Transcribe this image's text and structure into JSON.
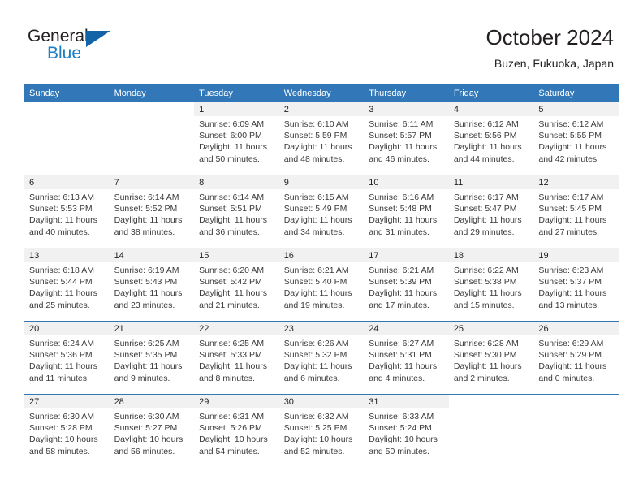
{
  "brand": {
    "word1": "General",
    "word2": "Blue",
    "logo_icon": "triangle-logo-icon",
    "accent_color": "#1263a8"
  },
  "header": {
    "title": "October 2024",
    "subtitle": "Buzen, Fukuoka, Japan"
  },
  "colors": {
    "header_blue": "#3278b9",
    "day_band_gray": "#f1f1f1",
    "text": "#231f20",
    "brand_blue": "#1c7fc4"
  },
  "weekdays": [
    "Sunday",
    "Monday",
    "Tuesday",
    "Wednesday",
    "Thursday",
    "Friday",
    "Saturday"
  ],
  "labels": {
    "sunrise_prefix": "Sunrise:",
    "sunset_prefix": "Sunset:",
    "daylight_prefix": "Daylight:"
  },
  "weeks": [
    [
      {
        "day": "",
        "sunrise": "",
        "sunset": "",
        "daylight": "",
        "blank": true
      },
      {
        "day": "",
        "sunrise": "",
        "sunset": "",
        "daylight": "",
        "blank": true
      },
      {
        "day": "1",
        "sunrise": "Sunrise: 6:09 AM",
        "sunset": "Sunset: 6:00 PM",
        "daylight": "Daylight: 11 hours and 50 minutes."
      },
      {
        "day": "2",
        "sunrise": "Sunrise: 6:10 AM",
        "sunset": "Sunset: 5:59 PM",
        "daylight": "Daylight: 11 hours and 48 minutes."
      },
      {
        "day": "3",
        "sunrise": "Sunrise: 6:11 AM",
        "sunset": "Sunset: 5:57 PM",
        "daylight": "Daylight: 11 hours and 46 minutes."
      },
      {
        "day": "4",
        "sunrise": "Sunrise: 6:12 AM",
        "sunset": "Sunset: 5:56 PM",
        "daylight": "Daylight: 11 hours and 44 minutes."
      },
      {
        "day": "5",
        "sunrise": "Sunrise: 6:12 AM",
        "sunset": "Sunset: 5:55 PM",
        "daylight": "Daylight: 11 hours and 42 minutes."
      }
    ],
    [
      {
        "day": "6",
        "sunrise": "Sunrise: 6:13 AM",
        "sunset": "Sunset: 5:53 PM",
        "daylight": "Daylight: 11 hours and 40 minutes."
      },
      {
        "day": "7",
        "sunrise": "Sunrise: 6:14 AM",
        "sunset": "Sunset: 5:52 PM",
        "daylight": "Daylight: 11 hours and 38 minutes."
      },
      {
        "day": "8",
        "sunrise": "Sunrise: 6:14 AM",
        "sunset": "Sunset: 5:51 PM",
        "daylight": "Daylight: 11 hours and 36 minutes."
      },
      {
        "day": "9",
        "sunrise": "Sunrise: 6:15 AM",
        "sunset": "Sunset: 5:49 PM",
        "daylight": "Daylight: 11 hours and 34 minutes."
      },
      {
        "day": "10",
        "sunrise": "Sunrise: 6:16 AM",
        "sunset": "Sunset: 5:48 PM",
        "daylight": "Daylight: 11 hours and 31 minutes."
      },
      {
        "day": "11",
        "sunrise": "Sunrise: 6:17 AM",
        "sunset": "Sunset: 5:47 PM",
        "daylight": "Daylight: 11 hours and 29 minutes."
      },
      {
        "day": "12",
        "sunrise": "Sunrise: 6:17 AM",
        "sunset": "Sunset: 5:45 PM",
        "daylight": "Daylight: 11 hours and 27 minutes."
      }
    ],
    [
      {
        "day": "13",
        "sunrise": "Sunrise: 6:18 AM",
        "sunset": "Sunset: 5:44 PM",
        "daylight": "Daylight: 11 hours and 25 minutes."
      },
      {
        "day": "14",
        "sunrise": "Sunrise: 6:19 AM",
        "sunset": "Sunset: 5:43 PM",
        "daylight": "Daylight: 11 hours and 23 minutes."
      },
      {
        "day": "15",
        "sunrise": "Sunrise: 6:20 AM",
        "sunset": "Sunset: 5:42 PM",
        "daylight": "Daylight: 11 hours and 21 minutes."
      },
      {
        "day": "16",
        "sunrise": "Sunrise: 6:21 AM",
        "sunset": "Sunset: 5:40 PM",
        "daylight": "Daylight: 11 hours and 19 minutes."
      },
      {
        "day": "17",
        "sunrise": "Sunrise: 6:21 AM",
        "sunset": "Sunset: 5:39 PM",
        "daylight": "Daylight: 11 hours and 17 minutes."
      },
      {
        "day": "18",
        "sunrise": "Sunrise: 6:22 AM",
        "sunset": "Sunset: 5:38 PM",
        "daylight": "Daylight: 11 hours and 15 minutes."
      },
      {
        "day": "19",
        "sunrise": "Sunrise: 6:23 AM",
        "sunset": "Sunset: 5:37 PM",
        "daylight": "Daylight: 11 hours and 13 minutes."
      }
    ],
    [
      {
        "day": "20",
        "sunrise": "Sunrise: 6:24 AM",
        "sunset": "Sunset: 5:36 PM",
        "daylight": "Daylight: 11 hours and 11 minutes."
      },
      {
        "day": "21",
        "sunrise": "Sunrise: 6:25 AM",
        "sunset": "Sunset: 5:35 PM",
        "daylight": "Daylight: 11 hours and 9 minutes."
      },
      {
        "day": "22",
        "sunrise": "Sunrise: 6:25 AM",
        "sunset": "Sunset: 5:33 PM",
        "daylight": "Daylight: 11 hours and 8 minutes."
      },
      {
        "day": "23",
        "sunrise": "Sunrise: 6:26 AM",
        "sunset": "Sunset: 5:32 PM",
        "daylight": "Daylight: 11 hours and 6 minutes."
      },
      {
        "day": "24",
        "sunrise": "Sunrise: 6:27 AM",
        "sunset": "Sunset: 5:31 PM",
        "daylight": "Daylight: 11 hours and 4 minutes."
      },
      {
        "day": "25",
        "sunrise": "Sunrise: 6:28 AM",
        "sunset": "Sunset: 5:30 PM",
        "daylight": "Daylight: 11 hours and 2 minutes."
      },
      {
        "day": "26",
        "sunrise": "Sunrise: 6:29 AM",
        "sunset": "Sunset: 5:29 PM",
        "daylight": "Daylight: 11 hours and 0 minutes."
      }
    ],
    [
      {
        "day": "27",
        "sunrise": "Sunrise: 6:30 AM",
        "sunset": "Sunset: 5:28 PM",
        "daylight": "Daylight: 10 hours and 58 minutes."
      },
      {
        "day": "28",
        "sunrise": "Sunrise: 6:30 AM",
        "sunset": "Sunset: 5:27 PM",
        "daylight": "Daylight: 10 hours and 56 minutes."
      },
      {
        "day": "29",
        "sunrise": "Sunrise: 6:31 AM",
        "sunset": "Sunset: 5:26 PM",
        "daylight": "Daylight: 10 hours and 54 minutes."
      },
      {
        "day": "30",
        "sunrise": "Sunrise: 6:32 AM",
        "sunset": "Sunset: 5:25 PM",
        "daylight": "Daylight: 10 hours and 52 minutes."
      },
      {
        "day": "31",
        "sunrise": "Sunrise: 6:33 AM",
        "sunset": "Sunset: 5:24 PM",
        "daylight": "Daylight: 10 hours and 50 minutes."
      },
      {
        "day": "",
        "sunrise": "",
        "sunset": "",
        "daylight": "",
        "blank": true
      },
      {
        "day": "",
        "sunrise": "",
        "sunset": "",
        "daylight": "",
        "blank": true
      }
    ]
  ]
}
